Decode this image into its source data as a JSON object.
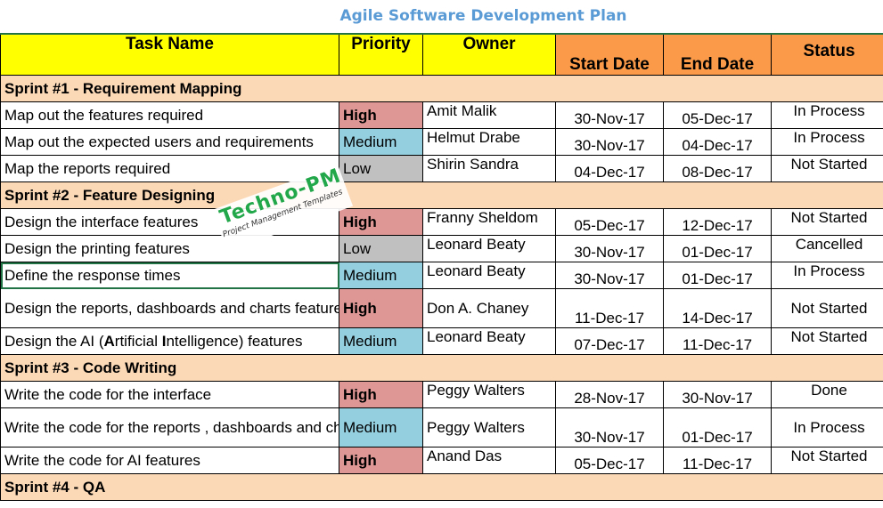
{
  "title": "Agile Software Development Plan",
  "columns": [
    "Task Name",
    "Priority",
    "Owner",
    "Start Date",
    "End Date",
    "Status"
  ],
  "colors": {
    "header_yellow": "#ffff00",
    "header_orange": "#fb9b4a",
    "sprint_row": "#fcd9b6",
    "priority_high": "#df9795",
    "priority_medium": "#94cfe0",
    "priority_low": "#c0c0c0",
    "title_blue": "#5b9bd5"
  },
  "watermark": {
    "main": "Techno-PM",
    "sub": "Project Management Templates"
  },
  "sprints": [
    {
      "name": "Sprint #1 - Requirement Mapping",
      "tasks": [
        {
          "task": "Map out the features required",
          "priority": "High",
          "owner": "Amit Malik",
          "start": "30-Nov-17",
          "end": "05-Dec-17",
          "status": "In Process"
        },
        {
          "task": "Map out the expected users and requirements",
          "priority": "Medium",
          "owner": "Helmut Drabe",
          "start": "30-Nov-17",
          "end": "04-Dec-17",
          "status": "In Process"
        },
        {
          "task": "Map the reports required",
          "priority": "Low",
          "owner": "Shirin Sandra",
          "start": "04-Dec-17",
          "end": "08-Dec-17",
          "status": "Not Started"
        }
      ]
    },
    {
      "name": "Sprint #2 - Feature Designing",
      "tasks": [
        {
          "task": "Design the interface features",
          "priority": "High",
          "owner": "Franny Sheldom",
          "start": "05-Dec-17",
          "end": "12-Dec-17",
          "status": "Not Started"
        },
        {
          "task": "Design the printing features",
          "priority": "Low",
          "owner": "Leonard Beaty",
          "start": "30-Nov-17",
          "end": "01-Dec-17",
          "status": "Cancelled"
        },
        {
          "task": "Define the response times",
          "priority": "Medium",
          "owner": "Leonard Beaty",
          "start": "30-Nov-17",
          "end": "01-Dec-17",
          "status": "In Process"
        },
        {
          "task": "Design the reports, dashboards and charts features",
          "priority": "High",
          "owner": "Don A. Chaney",
          "start": "11-Dec-17",
          "end": "14-Dec-17",
          "status": "Not Started"
        },
        {
          "task": "Design the AI (Artificial Intelligence) features",
          "priority": "Medium",
          "owner": "Leonard Beaty",
          "start": "07-Dec-17",
          "end": "11-Dec-17",
          "status": "Not Started"
        }
      ]
    },
    {
      "name": "Sprint #3 - Code Writing",
      "tasks": [
        {
          "task": "Write the code for the interface",
          "priority": "High",
          "owner": "Peggy Walters",
          "start": "28-Nov-17",
          "end": "30-Nov-17",
          "status": "Done"
        },
        {
          "task": "Write the code for the reports , dashboards and charts",
          "priority": "Medium",
          "owner": "Peggy Walters",
          "start": "30-Nov-17",
          "end": "01-Dec-17",
          "status": "In Process"
        },
        {
          "task": "Write the code for AI features",
          "priority": "High",
          "owner": "Anand Das",
          "start": "05-Dec-17",
          "end": "11-Dec-17",
          "status": "Not Started"
        }
      ]
    },
    {
      "name": "Sprint #4 - QA",
      "tasks": []
    }
  ]
}
